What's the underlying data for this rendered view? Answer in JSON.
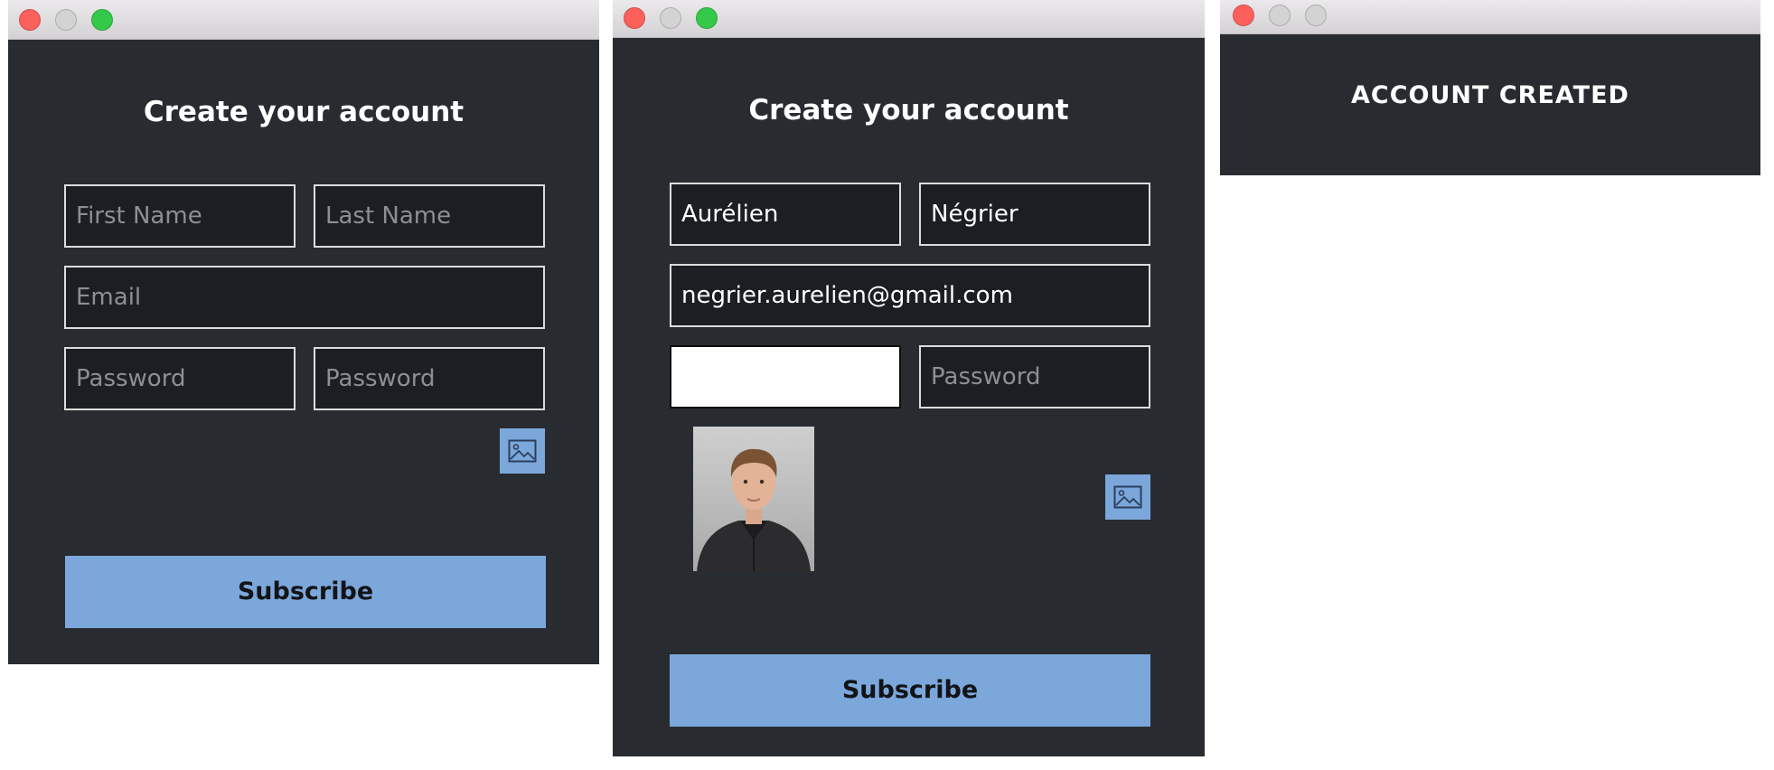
{
  "window1": {
    "title": "Create your account",
    "first_name_placeholder": "First Name",
    "last_name_placeholder": "Last Name",
    "email_placeholder": "Email",
    "password_placeholder": "Password",
    "password_confirm_placeholder": "Password",
    "subscribe_label": "Subscribe",
    "image_button_icon": "image-icon"
  },
  "window2": {
    "title": "Create your account",
    "first_name_value": "Aurélien",
    "last_name_value": "Négrier",
    "email_value": "negrier.aurelien@gmail.com",
    "password_value": "",
    "password_confirm_placeholder": "Password",
    "subscribe_label": "Subscribe",
    "image_button_icon": "image-icon",
    "photo": "profile-photo"
  },
  "window3": {
    "title": "ACCOUNT CREATED"
  },
  "colors": {
    "window_bg": "#282c31",
    "field_bg": "#1b1f23",
    "accent": "#7ba7db",
    "close": "#fc605b",
    "zoom": "#35c94a"
  }
}
